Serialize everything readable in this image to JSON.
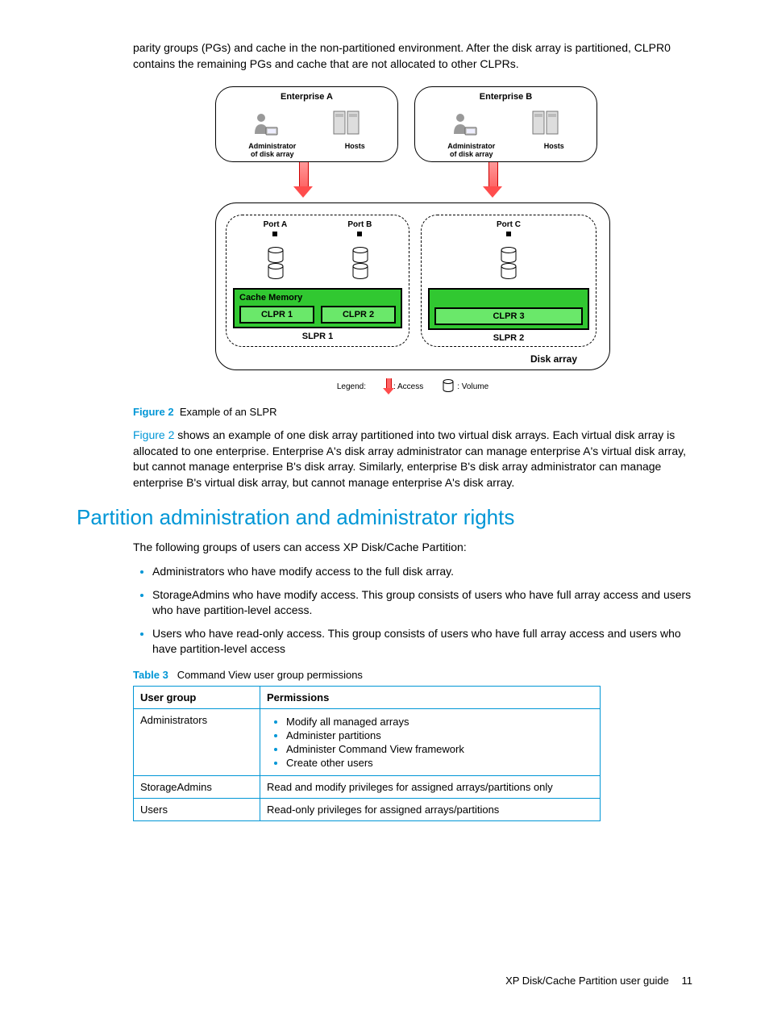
{
  "intro_paragraph": "parity groups (PGs) and cache in the non-partitioned environment. After the disk array is partitioned, CLPR0 contains the remaining PGs and cache that are not allocated to other CLPRs.",
  "diagram": {
    "enterpriseA": {
      "title": "Enterprise A",
      "admin_label": "Administrator\nof disk array",
      "hosts_label": "Hosts"
    },
    "enterpriseB": {
      "title": "Enterprise B",
      "admin_label": "Administrator\nof disk array",
      "hosts_label": "Hosts"
    },
    "ports": {
      "a": "Port A",
      "b": "Port B",
      "c": "Port C"
    },
    "cache_memory_label": "Cache Memory",
    "clpr": {
      "c1": "CLPR 1",
      "c2": "CLPR 2",
      "c3": "CLPR 3"
    },
    "slpr": {
      "s1": "SLPR 1",
      "s2": "SLPR 2"
    },
    "disk_array_label": "Disk array",
    "legend": {
      "title": "Legend:",
      "access": ": Access",
      "volume": ": Volume"
    }
  },
  "figure_caption": {
    "label": "Figure 2",
    "text": "Example of an SLPR"
  },
  "figure_desc": {
    "link_text": "Figure 2",
    "rest": " shows an example of one disk array partitioned into two virtual disk arrays. Each virtual disk array is allocated to one enterprise. Enterprise A's disk array administrator can manage enterprise A's virtual disk array, but cannot manage enterprise B's disk array. Similarly, enterprise B's disk array administrator can manage enterprise B's virtual disk array, but cannot manage enterprise A's disk array."
  },
  "heading": "Partition administration and administrator rights",
  "after_heading": "The following groups of users can access XP Disk/Cache Partition:",
  "access_list": [
    "Administrators who have modify access to the full disk array.",
    "StorageAdmins who have modify access. This group consists of users who have full array access and users who have partition-level access.",
    "Users who have read-only access. This group consists of users who have full array access and users who have partition-level access"
  ],
  "table_caption": {
    "label": "Table 3",
    "text": "Command View user group permissions"
  },
  "table": {
    "headers": {
      "col1": "User group",
      "col2": "Permissions"
    },
    "rows": [
      {
        "group": "Administrators",
        "perms_list": [
          "Modify all managed arrays",
          "Administer partitions",
          "Administer Command View framework",
          "Create other users"
        ]
      },
      {
        "group": "StorageAdmins",
        "perms_text": "Read and modify privileges for assigned arrays/partitions only"
      },
      {
        "group": "Users",
        "perms_text": "Read-only privileges for assigned arrays/partitions"
      }
    ]
  },
  "footer": {
    "title": "XP Disk/Cache Partition user guide",
    "page": "11"
  }
}
